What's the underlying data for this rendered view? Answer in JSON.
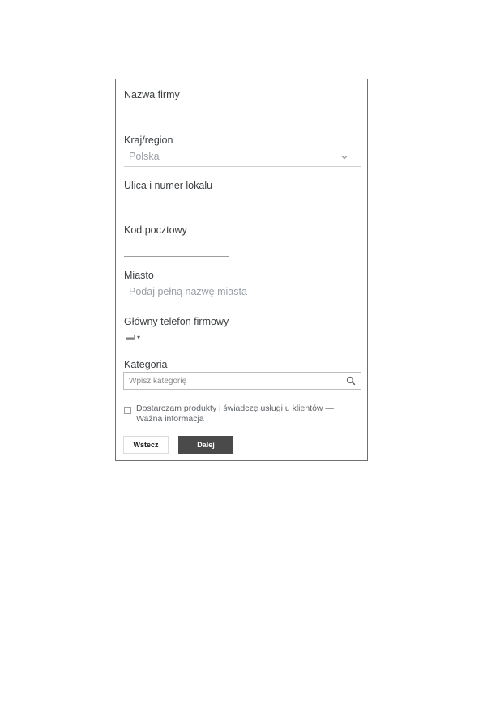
{
  "form": {
    "company_name": {
      "label": "Nazwa firmy",
      "value": ""
    },
    "country": {
      "label": "Kraj/region",
      "value": "Polska"
    },
    "street": {
      "label": "Ulica i numer lokalu",
      "value": ""
    },
    "postal": {
      "label": "Kod pocztowy",
      "value": ""
    },
    "city": {
      "label": "Miasto",
      "placeholder": "Podaj pełną nazwę miasta"
    },
    "phone": {
      "label": "Główny telefon firmowy"
    },
    "category": {
      "label": "Kategoria",
      "placeholder": "Wpisz kategorię"
    },
    "delivery": {
      "text_line1": "Dostarczam produkty i świadczę usługi u klientów —",
      "text_line2": "Ważna informacja",
      "checked": false
    },
    "buttons": {
      "back": "Wstecz",
      "next": "Dalej"
    }
  },
  "icons": [
    "chevron-down-icon",
    "flag-icon",
    "dropdown-arrow-icon",
    "search-icon"
  ]
}
